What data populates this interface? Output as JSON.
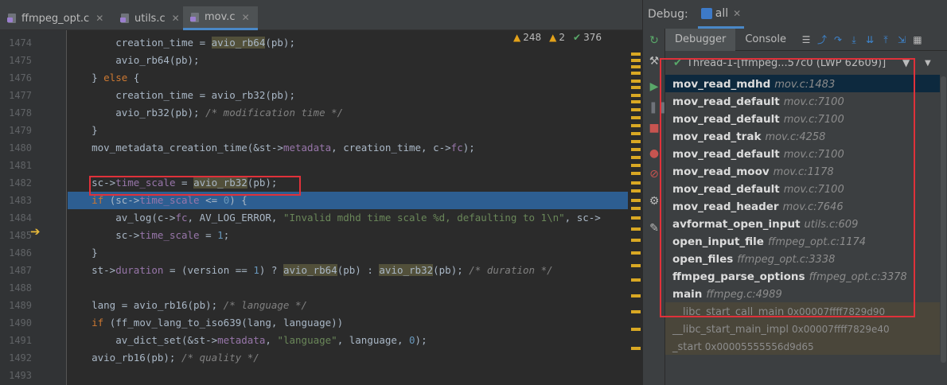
{
  "tabs": [
    {
      "label": "ffmpeg_opt.c",
      "active": false
    },
    {
      "label": "utils.c",
      "active": false
    },
    {
      "label": "mov.c",
      "active": true
    }
  ],
  "inspections": {
    "warnings": "248",
    "weak_warnings": "2",
    "typos": "376"
  },
  "editor": {
    "lines": [
      {
        "num": "1474",
        "html": "        creation_time = <span class=\"hl\">avio_rb64</span>(pb);"
      },
      {
        "num": "1475",
        "html": "        avio_rb64(pb);"
      },
      {
        "num": "1476",
        "html": "    } <span class=\"kw\">else</span> {"
      },
      {
        "num": "1477",
        "html": "        creation_time = avio_rb32(pb);"
      },
      {
        "num": "1478",
        "html": "        avio_rb32(pb); <span class=\"cmt\">/* modification time */</span>"
      },
      {
        "num": "1479",
        "html": "    }"
      },
      {
        "num": "1480",
        "html": "    mov_metadata_creation_time(&amp;st-&gt;<span class=\"fld\">metadata</span>, creation_time, c-&gt;<span class=\"fld\">fc</span>);"
      },
      {
        "num": "1481",
        "html": ""
      },
      {
        "num": "1482",
        "html": "    sc-&gt;<span class=\"fld\">time_scale</span> = <span class=\"hl\">avio_rb32</span>(pb);"
      },
      {
        "num": "1483",
        "html": "    <span class=\"kw\">if</span> (sc-&gt;<span class=\"fld\">time_scale</span> &lt;= <span class=\"num\">0</span>) {"
      },
      {
        "num": "1484",
        "html": "        av_log(c-&gt;<span class=\"fld\">fc</span>, AV_LOG_ERROR, <span class=\"str\">\"Invalid mdhd time scale %d, defaulting to 1\\n\"</span>, sc-&gt;"
      },
      {
        "num": "1485",
        "html": "        sc-&gt;<span class=\"fld\">time_scale</span> = <span class=\"num\">1</span>;"
      },
      {
        "num": "1486",
        "html": "    }"
      },
      {
        "num": "1487",
        "html": "    st-&gt;<span class=\"fld\">duration</span> = (version == <span class=\"num\">1</span>) ? <span class=\"hl\">avio_rb64</span>(pb) : <span class=\"hl\">avio_rb32</span>(pb); <span class=\"cmt\">/* duration */</span>"
      },
      {
        "num": "1488",
        "html": ""
      },
      {
        "num": "1489",
        "html": "    lang = avio_rb16(pb); <span class=\"cmt\">/* language */</span>"
      },
      {
        "num": "1490",
        "html": "    <span class=\"kw\">if</span> (ff_mov_lang_to_iso639(lang, language))"
      },
      {
        "num": "1491",
        "html": "        av_dict_set(&amp;st-&gt;<span class=\"fld\">metadata</span>, <span class=\"str\">\"language\"</span>, language, <span class=\"num\">0</span>);"
      },
      {
        "num": "1492",
        "html": "    avio_rb16(pb); <span class=\"cmt\">/* quality */</span>"
      },
      {
        "num": "1493",
        "html": ""
      }
    ],
    "exec_line": "1483"
  },
  "debug": {
    "title": "Debug:",
    "config": "all",
    "tab_debugger": "Debugger",
    "tab_console": "Console",
    "thread": "Thread-1-[ffmpeg...57c0 (LWP 62609)]",
    "frames": [
      {
        "fn": "mov_read_mdhd",
        "loc": "mov.c:1483",
        "kind": "selected"
      },
      {
        "fn": "mov_read_default",
        "loc": "mov.c:7100",
        "kind": "normal"
      },
      {
        "fn": "mov_read_default",
        "loc": "mov.c:7100",
        "kind": "normal"
      },
      {
        "fn": "mov_read_trak",
        "loc": "mov.c:4258",
        "kind": "normal"
      },
      {
        "fn": "mov_read_default",
        "loc": "mov.c:7100",
        "kind": "normal"
      },
      {
        "fn": "mov_read_moov",
        "loc": "mov.c:1178",
        "kind": "normal"
      },
      {
        "fn": "mov_read_default",
        "loc": "mov.c:7100",
        "kind": "normal"
      },
      {
        "fn": "mov_read_header",
        "loc": "mov.c:7646",
        "kind": "normal"
      },
      {
        "fn": "avformat_open_input",
        "loc": "utils.c:609",
        "kind": "normal"
      },
      {
        "fn": "open_input_file",
        "loc": "ffmpeg_opt.c:1174",
        "kind": "normal"
      },
      {
        "fn": "open_files",
        "loc": "ffmpeg_opt.c:3338",
        "kind": "normal"
      },
      {
        "fn": "ffmpeg_parse_options",
        "loc": "ffmpeg_opt.c:3378",
        "kind": "normal"
      },
      {
        "fn": "main",
        "loc": "ffmpeg.c:4989",
        "kind": "normal"
      },
      {
        "fn": "__libc_start_call_main",
        "loc": "0x00007ffff7829d90",
        "kind": "lib"
      },
      {
        "fn": "__libc_start_main_impl",
        "loc": "0x00007ffff7829e40",
        "kind": "lib"
      },
      {
        "fn": "_start",
        "loc": "0x00005555556d9d65",
        "kind": "lib"
      }
    ]
  },
  "colors": {
    "accent": "#4a88c7",
    "highlight_box": "#e0313a",
    "exec_line": "#2d5e91"
  }
}
